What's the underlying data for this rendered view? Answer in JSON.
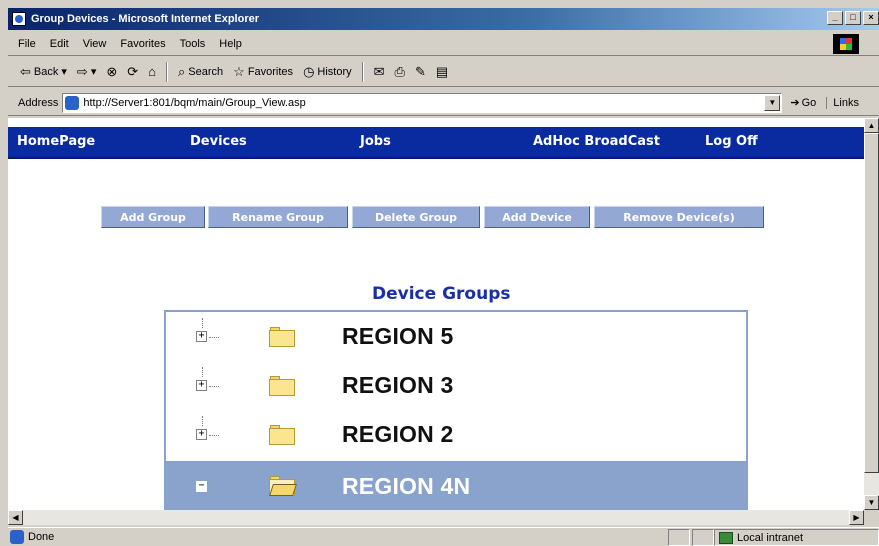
{
  "window": {
    "title": "Group Devices - Microsoft Internet Explorer",
    "minimize": "_",
    "maximize": "□",
    "close": "×"
  },
  "menu": [
    "File",
    "Edit",
    "View",
    "Favorites",
    "Tools",
    "Help"
  ],
  "toolbar": {
    "back": "Back",
    "search": "Search",
    "favorites": "Favorites",
    "history": "History"
  },
  "address": {
    "label": "Address",
    "url": "http://Server1:801/bqm/main/Group_View.asp",
    "go": "Go",
    "links": "Links"
  },
  "nav": {
    "items": [
      "HomePage",
      "Devices",
      "Jobs",
      "AdHoc BroadCast",
      "Log Off"
    ]
  },
  "actions": [
    "Add Group",
    "Rename Group",
    "Delete Group",
    "Add Device",
    "Remove Device(s)"
  ],
  "groups": {
    "title": "Device Groups",
    "rows": [
      {
        "label": "REGION 5",
        "expander": "+",
        "selected": false
      },
      {
        "label": "REGION 3",
        "expander": "+",
        "selected": false
      },
      {
        "label": "REGION 2",
        "expander": "+",
        "selected": false
      },
      {
        "label": "REGION 4N",
        "expander": "−",
        "selected": true
      }
    ]
  },
  "status": {
    "text": "Done",
    "zone": "Local intranet"
  }
}
